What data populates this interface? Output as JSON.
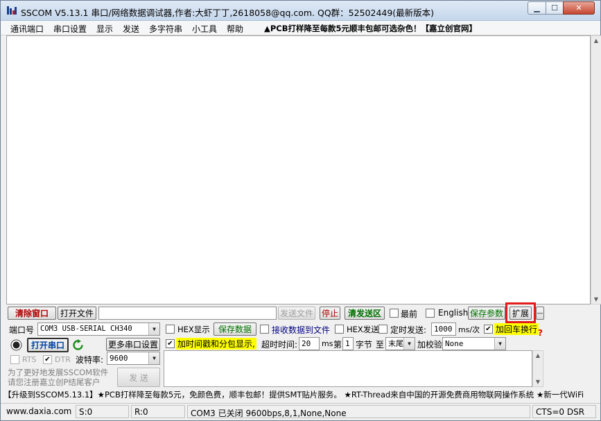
{
  "window": {
    "title": "SSCOM V5.13.1 串口/网络数据调试器,作者:大虾丁丁,2618058@qq.com. QQ群：52502449(最新版本)",
    "buttons": {
      "minimize": "▁",
      "maximize": "☐",
      "close": "✕"
    }
  },
  "menu": [
    "通讯端口",
    "串口设置",
    "显示",
    "发送",
    "多字符串",
    "小工具",
    "帮助",
    "▲PCB打样降至每款5元顺丰包邮可选杂色！【嘉立创官网】"
  ],
  "toolbar": {
    "clear_window": "清除窗口",
    "open_file": "打开文件",
    "file_path": "",
    "send_file": "发送文件",
    "stop": "停止",
    "clear_send": "清发送区",
    "latest": "最前",
    "english": "English",
    "save_params": "保存参数",
    "expand": "扩展",
    "dash": "—"
  },
  "port": {
    "port_label": "端口号",
    "port_value": "COM3 USB-SERIAL CH340",
    "open_port": "打开串口",
    "more_settings": "更多串口设置",
    "rts": "RTS",
    "dtr": "DTR",
    "baud_label": "波特率:",
    "baud_value": "9600",
    "promo_line1": "为了更好地发展SSCOM软件",
    "promo_line2": "请您注册嘉立创P结尾客户"
  },
  "options": {
    "hex_display": "HEX显示",
    "save_data": "保存数据",
    "recv_to_file": "接收数据到文件",
    "hex_send": "HEX发送",
    "timed_send": "定时发送:",
    "interval": "1000",
    "interval_unit": "ms/次",
    "add_crlf": "加回车换行",
    "timestamp": "加时间戳和分包显示,",
    "timeout_label": "超时时间:",
    "timeout_value": "20",
    "timeout_unit": "ms",
    "seq_label": "第",
    "seq_value": "1",
    "byte_label": "字节",
    "to_label": "至",
    "end_value": "末尾",
    "checksum_label": "加校验",
    "checksum_value": "None",
    "send_button": "发  送"
  },
  "ticker": "【升级到SSCOM5.13.1】★PCB打样降至每款5元，免颜色费，顺丰包邮！提供SMT贴片服务。 ★RT-Thread来自中国的开源免费商用物联网操作系统 ★新一代WiFi",
  "status": {
    "website": "www.daxia.com",
    "sent": "S:0",
    "received": "R:0",
    "port_status": "COM3 已关闭  9600bps,8,1,None,None",
    "signals": "CTS=0 DSR"
  }
}
